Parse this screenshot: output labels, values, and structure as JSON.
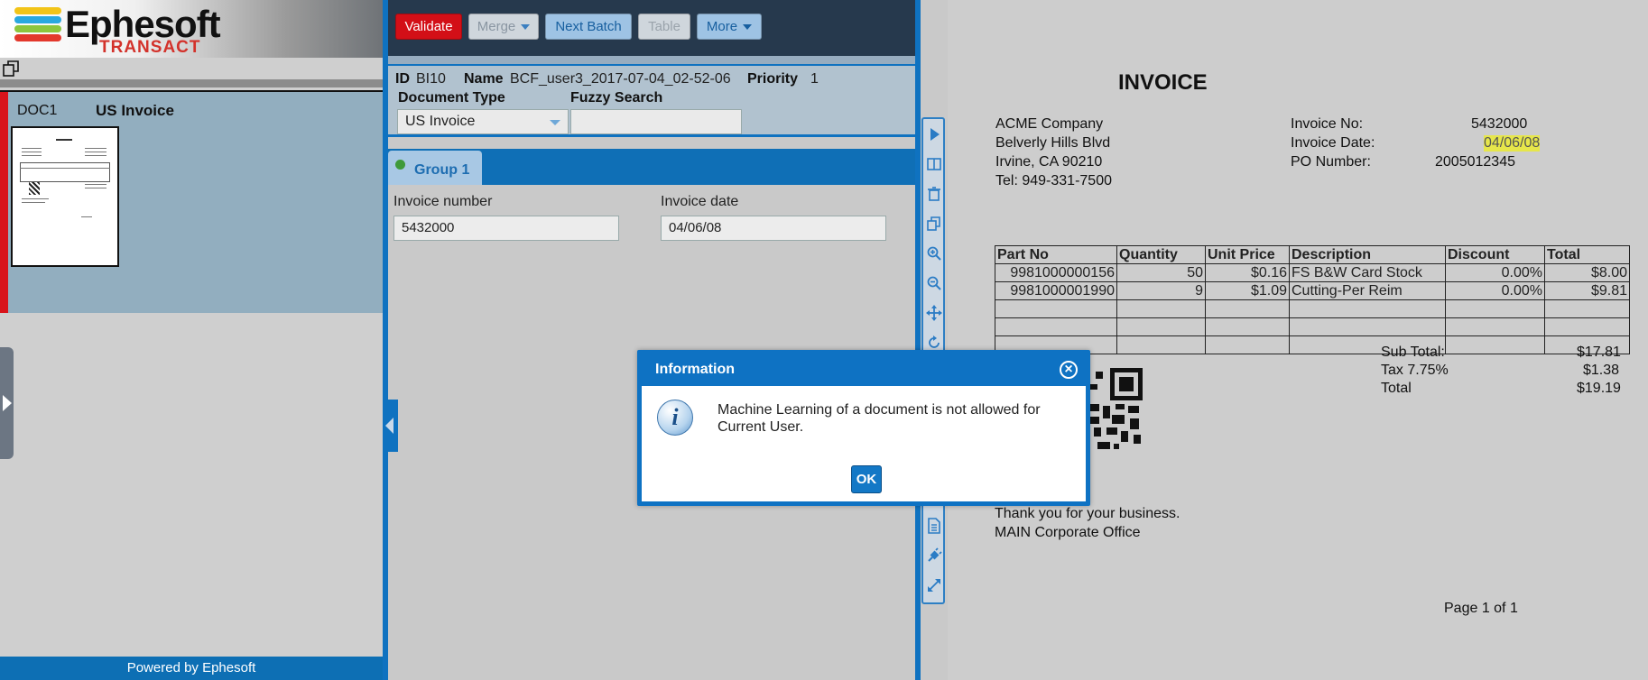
{
  "branding": {
    "logo_main": "Ephesoft",
    "logo_sub": "TRANSACT",
    "footer": "Powered by Ephesoft"
  },
  "document_list": {
    "doc_id": "DOC1",
    "doc_type": "US Invoice"
  },
  "toolbar": {
    "validate": "Validate",
    "merge": "Merge",
    "next_batch": "Next Batch",
    "table": "Table",
    "more": "More"
  },
  "batch": {
    "id_label": "ID",
    "id_value": "BI10",
    "name_label": "Name",
    "name_value": "BCF_user3_2017-07-04_02-52-06",
    "priority_label": "Priority",
    "priority_value": "1",
    "doc_type_label": "Document Type",
    "doc_type_value": "US Invoice",
    "fuzzy_label": "Fuzzy Search",
    "fuzzy_value": ""
  },
  "group": {
    "label": "Group 1"
  },
  "fields": {
    "invoice_number_label": "Invoice number",
    "invoice_number_value": "5432000",
    "invoice_date_label": "Invoice date",
    "invoice_date_value": "04/06/08"
  },
  "invoice": {
    "title": "INVOICE",
    "company": [
      "ACME Company",
      "Belverly Hills Blvd",
      "Irvine, CA 90210",
      "Tel: 949-331-7500"
    ],
    "meta": [
      {
        "label": "Invoice No:",
        "value": "5432000"
      },
      {
        "label": "Invoice Date:",
        "value": "04/06/08"
      },
      {
        "label": "PO Number:",
        "value": "2005012345"
      }
    ],
    "table_headers": [
      "Part No",
      "Quantity",
      "Unit Price",
      "Description",
      "Discount",
      "Total"
    ],
    "rows": [
      [
        "9981000000156",
        "50",
        "$0.16",
        "FS B&W Card Stock",
        "0.00%",
        "$8.00"
      ],
      [
        "9981000001990",
        "9",
        "$1.09",
        "Cutting-Per Reim",
        "0.00%",
        "$9.81"
      ]
    ],
    "totals": [
      {
        "label": "Sub Total:",
        "value": "$17.81"
      },
      {
        "label": "Tax 7.75%",
        "value": "$1.38"
      },
      {
        "label": "Total",
        "value": "$19.19"
      }
    ],
    "footer": [
      "Thank you for your business.",
      "MAIN Corporate Office"
    ],
    "page": "Page 1 of 1"
  },
  "dialog": {
    "title": "Information",
    "message": "Machine Learning of a document is not allowed for Current User.",
    "ok": "OK",
    "close_icon": "×",
    "info_icon": "i"
  },
  "colors": {
    "accent": "#0f72c0",
    "validate": "#d30f17",
    "toolbar_bg": "#26394d"
  }
}
